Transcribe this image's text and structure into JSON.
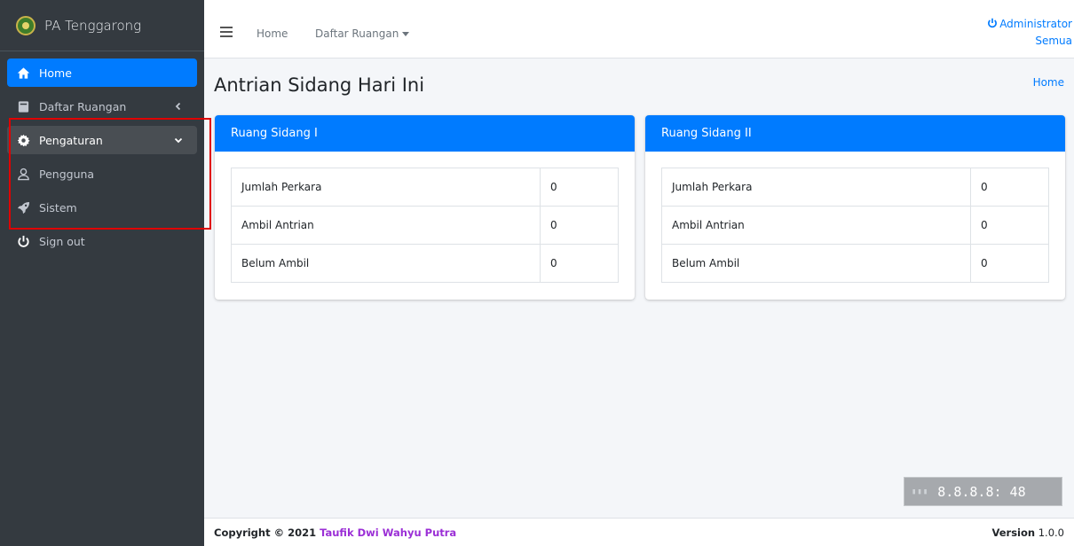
{
  "sidebar": {
    "brand": "PA Tenggarong",
    "items": [
      {
        "label": "Home",
        "icon": "home-icon"
      },
      {
        "label": "Daftar Ruangan",
        "icon": "book-icon"
      },
      {
        "label": "Pengaturan",
        "icon": "gear-icon"
      },
      {
        "label": "Pengguna",
        "icon": "user-icon"
      },
      {
        "label": "Sistem",
        "icon": "rocket-icon"
      },
      {
        "label": "Sign out",
        "icon": "power-icon"
      }
    ]
  },
  "topbar": {
    "home": "Home",
    "rooms": "Daftar Ruangan",
    "user_name": "Administrator",
    "user_role": "Semua"
  },
  "header": {
    "title": "Antrian Sidang Hari Ini",
    "breadcrumb": "Home"
  },
  "cards": [
    {
      "title": "Ruang Sidang I",
      "rows": [
        {
          "label": "Jumlah Perkara",
          "value": "0"
        },
        {
          "label": "Ambil Antrian",
          "value": "0"
        },
        {
          "label": "Belum Ambil",
          "value": "0"
        }
      ]
    },
    {
      "title": "Ruang Sidang II",
      "rows": [
        {
          "label": "Jumlah Perkara",
          "value": "0"
        },
        {
          "label": "Ambil Antrian",
          "value": "0"
        },
        {
          "label": "Belum Ambil",
          "value": "0"
        }
      ]
    }
  ],
  "clock": {
    "value": "8.8.8.8: 48"
  },
  "footer": {
    "copyright_prefix": "Copyright © 2021 ",
    "author": "Taufik Dwi Wahyu Putra",
    "version_label": "Version",
    "version_number": "1.0.0"
  },
  "colors": {
    "primary": "#007bff",
    "sidebar_bg": "#343a40",
    "highlight": "#e00000"
  }
}
